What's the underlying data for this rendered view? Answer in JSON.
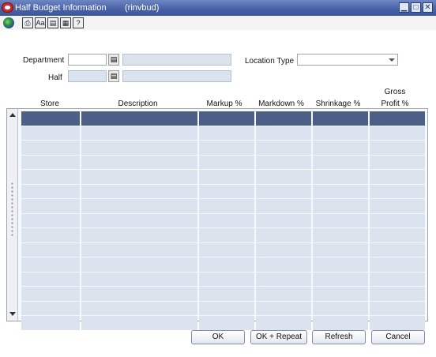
{
  "window": {
    "title": "Half Budget Information",
    "subtitle": "(rinvbud)",
    "controls": {
      "minimize": "▁",
      "maximize": "□",
      "close": "✕"
    }
  },
  "toolbar": {
    "icons": [
      "globe-icon",
      "print-icon",
      "spellcheck-icon",
      "notes-icon",
      "calendar-icon",
      "help-icon"
    ],
    "glyphs": [
      "⎙",
      "Aa",
      "▤",
      "▦",
      "?"
    ]
  },
  "form": {
    "department_label": "Department",
    "half_label": "Half",
    "location_type_label": "Location Type",
    "department_value": "",
    "half_value": "",
    "location_type_value": ""
  },
  "table": {
    "columns": [
      "Store",
      "Description",
      "Markup %",
      "Markdown %",
      "Shrinkage %",
      "Gross Profit %"
    ],
    "gross_line1": "Gross",
    "gross_line2": "Profit %",
    "row_count": 15
  },
  "buttons": {
    "ok": "OK",
    "ok_repeat": "OK + Repeat",
    "refresh": "Refresh",
    "cancel": "Cancel"
  },
  "colors": {
    "titlebar": "#4a63a8",
    "selected_row": "#4c5f86",
    "cell": "#dbe3ef"
  }
}
